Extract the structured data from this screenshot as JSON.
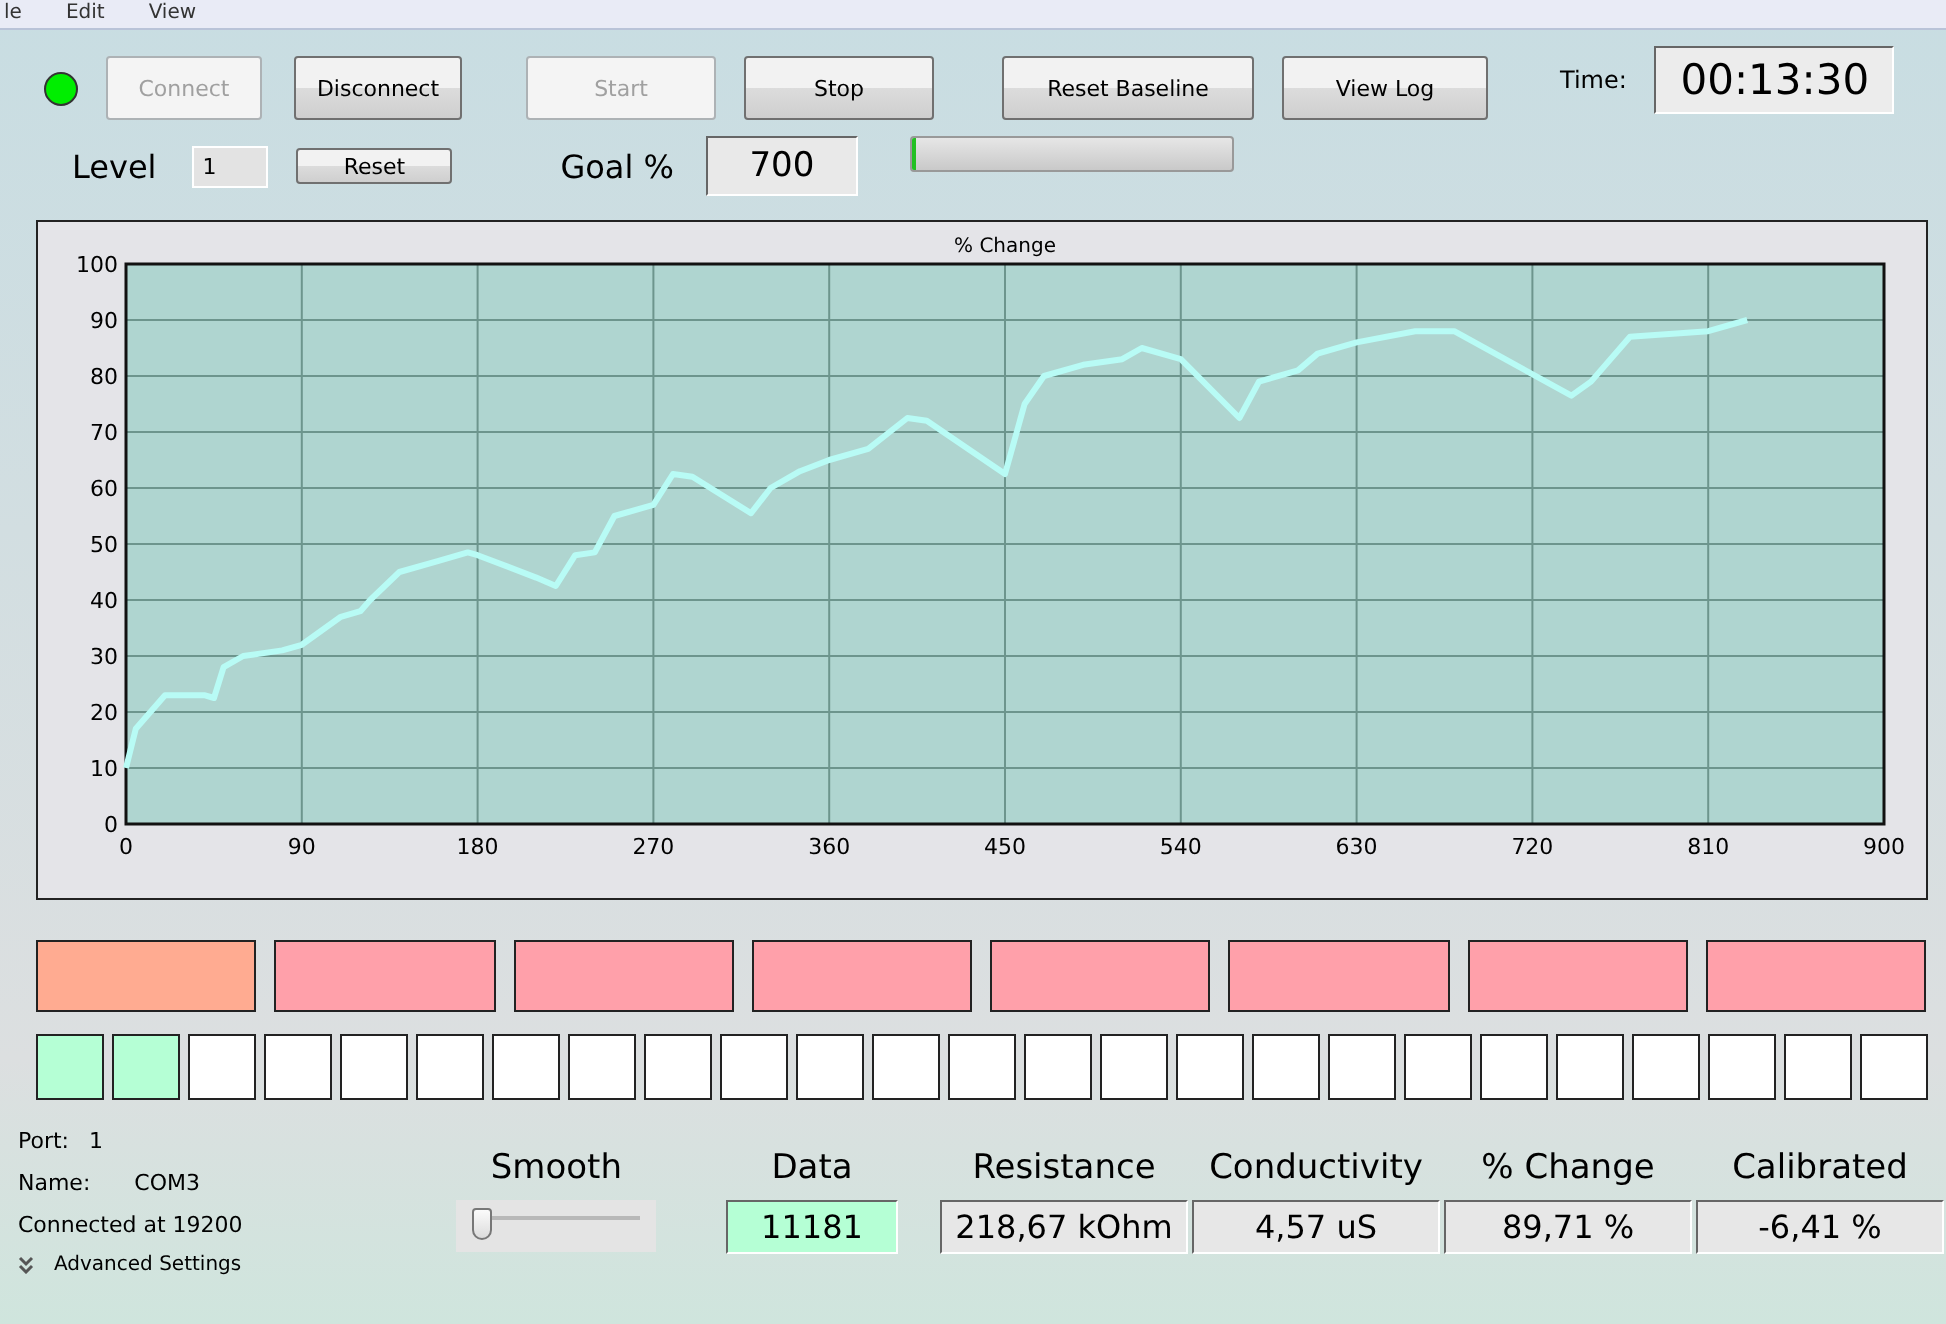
{
  "menu": [
    "le",
    "Edit",
    "View"
  ],
  "status_led": {
    "color": "#00ee00"
  },
  "buttons": [
    {
      "label": "Connect",
      "disabled": true
    },
    {
      "label": "Disconnect",
      "disabled": false
    },
    {
      "label": "Start",
      "disabled": true
    },
    {
      "label": "Stop",
      "disabled": false
    },
    {
      "label": "Reset Baseline",
      "disabled": false
    },
    {
      "label": "View Log",
      "disabled": false
    }
  ],
  "time": {
    "label": "Time:",
    "value": "00:13:30"
  },
  "level": {
    "label": "Level",
    "value": "1",
    "button": "Reset"
  },
  "goal": {
    "label": "Goal %",
    "value": "700"
  },
  "goal_progress": {
    "level": 0.01
  },
  "chart": {
    "chart_data": {
      "type": "line",
      "title": "% Change",
      "grid": true,
      "xlim": [
        0,
        900
      ],
      "ylim": [
        0,
        100
      ],
      "xticks": [
        0,
        90,
        180,
        270,
        360,
        450,
        540,
        630,
        720,
        810,
        900
      ],
      "yticks": [
        0,
        10,
        20,
        30,
        40,
        50,
        60,
        70,
        80,
        90,
        100
      ],
      "x": [
        0,
        5,
        20,
        40,
        45,
        50,
        60,
        80,
        90,
        110,
        120,
        125,
        140,
        160,
        175,
        180,
        210,
        220,
        230,
        240,
        250,
        270,
        280,
        290,
        320,
        330,
        345,
        360,
        380,
        400,
        410,
        450,
        460,
        470,
        490,
        510,
        520,
        540,
        570,
        580,
        600,
        610,
        630,
        660,
        680,
        740,
        750,
        770,
        790,
        810,
        830
      ],
      "series": [
        {
          "color": "#b8fbf5",
          "values": [
            10,
            17,
            23,
            23,
            22.5,
            28,
            30,
            31,
            32,
            37,
            38,
            40,
            45,
            47,
            48.5,
            48,
            44,
            42.5,
            48,
            48.5,
            55,
            57,
            62.5,
            62,
            55.5,
            60,
            63,
            65,
            67,
            72.5,
            72,
            62.5,
            75,
            80,
            82,
            83,
            85,
            83,
            72.5,
            79,
            81,
            84,
            86,
            88,
            88,
            76.5,
            79,
            87,
            87.5,
            88,
            90
          ]
        }
      ]
    }
  },
  "blocks": [
    {
      "color": "#ffab91"
    },
    {
      "color": "#ffa0aa"
    },
    {
      "color": "#ffa0aa"
    },
    {
      "color": "#ffa0aa"
    },
    {
      "color": "#ffa0aa"
    },
    {
      "color": "#ffa0aa"
    },
    {
      "color": "#ffa0aa"
    },
    {
      "color": "#ffa0aa"
    }
  ],
  "squares": [
    {
      "color": "#b5ffd5"
    },
    {
      "color": "#b5ffd5"
    },
    {
      "color": "#ffffff"
    },
    {
      "color": "#ffffff"
    },
    {
      "color": "#ffffff"
    },
    {
      "color": "#ffffff"
    },
    {
      "color": "#ffffff"
    },
    {
      "color": "#ffffff"
    },
    {
      "color": "#ffffff"
    },
    {
      "color": "#ffffff"
    },
    {
      "color": "#ffffff"
    },
    {
      "color": "#ffffff"
    },
    {
      "color": "#ffffff"
    },
    {
      "color": "#ffffff"
    },
    {
      "color": "#ffffff"
    },
    {
      "color": "#ffffff"
    },
    {
      "color": "#ffffff"
    },
    {
      "color": "#ffffff"
    },
    {
      "color": "#ffffff"
    },
    {
      "color": "#ffffff"
    },
    {
      "color": "#ffffff"
    },
    {
      "color": "#ffffff"
    },
    {
      "color": "#ffffff"
    },
    {
      "color": "#ffffff"
    },
    {
      "color": "#ffffff"
    }
  ],
  "connection": {
    "port_label": "Port:",
    "port": "1",
    "name_label": "Name:",
    "name": "COM3",
    "status": "Connected at 19200",
    "advanced": "Advanced Settings"
  },
  "smooth": {
    "label": "Smooth",
    "level": 0.0
  },
  "readouts": [
    {
      "label": "Data",
      "value": "11181",
      "highlight": true
    },
    {
      "label": "Resistance",
      "value": "218,67 kOhm",
      "highlight": false
    },
    {
      "label": "Conductivity",
      "value": "4,57 uS",
      "highlight": false
    },
    {
      "label": "% Change",
      "value": "89,71 %",
      "highlight": false
    },
    {
      "label": "Calibrated",
      "value": "-6,41 %",
      "highlight": false
    }
  ]
}
